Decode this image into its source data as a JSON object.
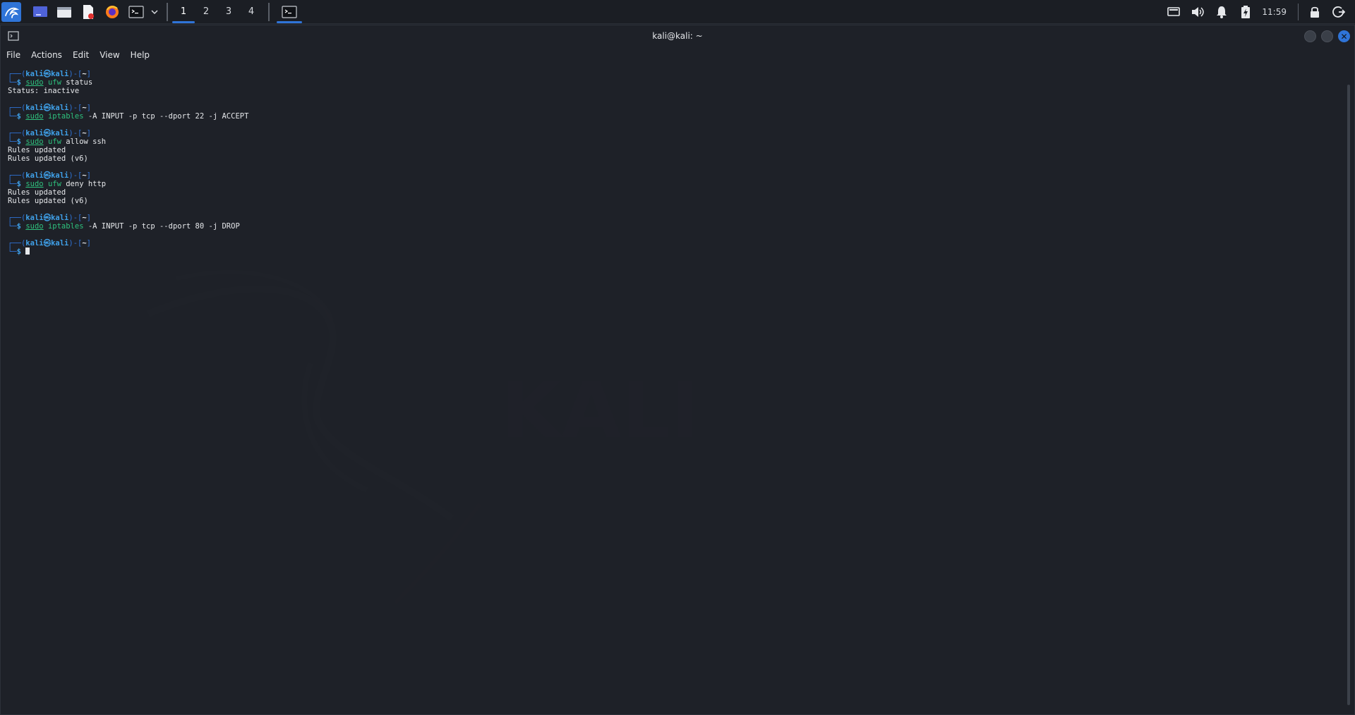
{
  "panel": {
    "workspaces": [
      "1",
      "2",
      "3",
      "4"
    ],
    "active_workspace": "1",
    "clock": "11:59",
    "launcher_icon": "kali-dragon-icon",
    "apps": [
      "desktop-icon",
      "file-manager-icon",
      "text-editor-icon",
      "firefox-icon",
      "terminal-icon"
    ],
    "tray": [
      "display-icon",
      "volume-icon",
      "bell-icon",
      "battery-icon",
      "lock-icon",
      "logout-icon"
    ]
  },
  "window": {
    "title": "kali@kali: ~",
    "menu": [
      "File",
      "Actions",
      "Edit",
      "View",
      "Help"
    ]
  },
  "prompt": {
    "top_prefix": "┌──(",
    "user_host": "kali㉿kali",
    "top_suffix": ")-[",
    "dir": "~",
    "close_bracket": "]",
    "bottom_prefix": "└─",
    "dollar": "$"
  },
  "commands": [
    {
      "sudo": "sudo",
      "program": "ufw",
      "args": " status",
      "output": [
        "Status: inactive"
      ]
    },
    {
      "sudo": "sudo",
      "program": "iptables",
      "args": " -A INPUT -p tcp --dport 22 -j ACCEPT",
      "output": []
    },
    {
      "sudo": "sudo",
      "program": "ufw",
      "args": " allow ssh",
      "output": [
        "Rules updated",
        "Rules updated (v6)"
      ]
    },
    {
      "sudo": "sudo",
      "program": "ufw",
      "args": " deny http",
      "output": [
        "Rules updated",
        "Rules updated (v6)"
      ]
    },
    {
      "sudo": "sudo",
      "program": "iptables",
      "args": " -A INPUT -p tcp --dport 80 -j DROP",
      "output": []
    }
  ],
  "colors": {
    "accent": "#2f74d8",
    "prompt_user": "#3fa0e8",
    "command": "#2ec27e",
    "text": "#e6e8eb",
    "background": "#1e2128"
  }
}
